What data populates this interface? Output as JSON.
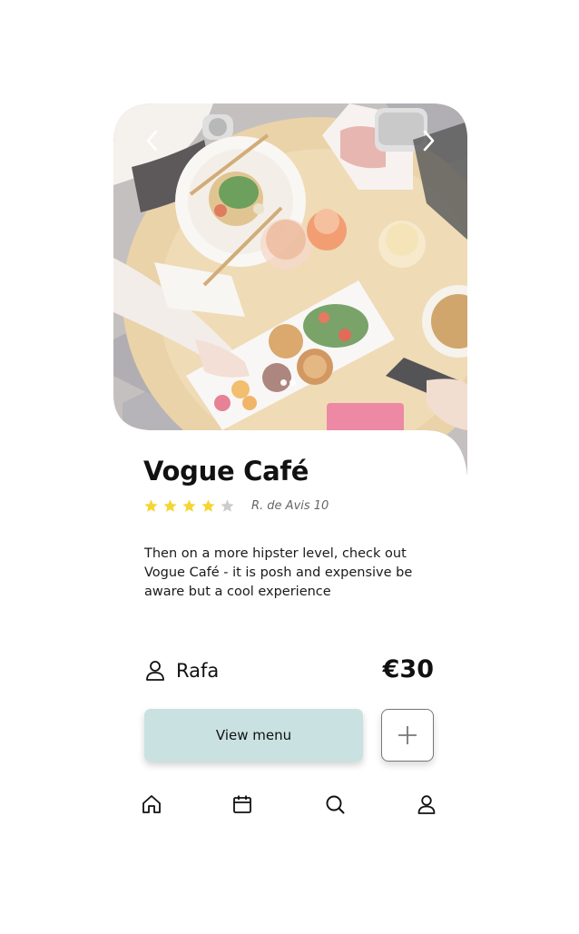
{
  "venue": {
    "name": "Vogue Café",
    "rating": 4,
    "rating_max": 5,
    "address": "R. de Avis 10",
    "description": "Then on a more hipster level, check out Vogue Café - it is posh and expensive be aware but a cool experience"
  },
  "host": {
    "name": "Rafa",
    "icon": "user-icon"
  },
  "price": "€30",
  "actions": {
    "view_menu_label": "View menu",
    "add_icon": "plus-icon"
  },
  "carousel": {
    "slide_count": 2,
    "prev_icon": "chevron-left-icon",
    "next_icon": "chevron-right-icon"
  },
  "bottom_nav": [
    {
      "icon": "home-icon"
    },
    {
      "icon": "calendar-icon"
    },
    {
      "icon": "search-icon"
    },
    {
      "icon": "profile-icon"
    }
  ],
  "colors": {
    "star_filled": "#f5d531",
    "star_empty": "#cccccc",
    "button_bg": "#c9e2e1"
  }
}
